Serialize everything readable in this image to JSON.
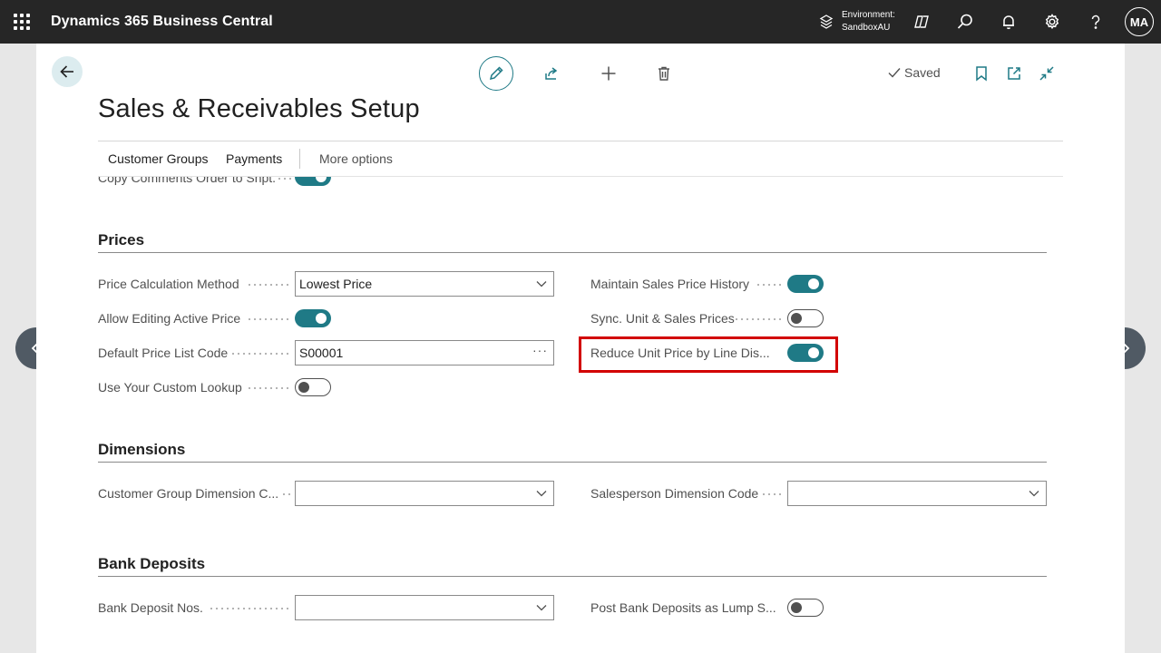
{
  "app": {
    "title": "Dynamics 365 Business Central"
  },
  "topbar": {
    "environment_label": "Environment:",
    "environment_name": "SandboxAU",
    "user_initials": "MA"
  },
  "toolbar": {
    "saved_label": "Saved"
  },
  "page": {
    "title": "Sales & Receivables Setup"
  },
  "tabs": [
    {
      "label": "Customer Groups"
    },
    {
      "label": "Payments"
    },
    {
      "label": "More options"
    }
  ],
  "partial_field": {
    "label": "Copy Comments Order to Shpt.",
    "value": true
  },
  "sections": {
    "prices": {
      "title": "Prices",
      "price_calc": {
        "label": "Price Calculation Method",
        "value": "Lowest Price"
      },
      "allow_edit": {
        "label": "Allow Editing Active Price",
        "value": true
      },
      "default_price_list": {
        "label": "Default Price List Code",
        "value": "S00001"
      },
      "custom_lookup": {
        "label": "Use Your Custom Lookup",
        "value": false
      },
      "maintain_history": {
        "label": "Maintain Sales Price History",
        "value": true
      },
      "sync_unit": {
        "label": "Sync. Unit & Sales Prices",
        "value": false
      },
      "reduce_unit": {
        "label": "Reduce Unit Price by Line Dis...",
        "value": true
      }
    },
    "dimensions": {
      "title": "Dimensions",
      "customer_group_dim": {
        "label": "Customer Group Dimension C...",
        "value": ""
      },
      "salesperson_dim": {
        "label": "Salesperson Dimension Code",
        "value": ""
      }
    },
    "bank_deposits": {
      "title": "Bank Deposits",
      "bank_deposit_nos": {
        "label": "Bank Deposit Nos.",
        "value": ""
      },
      "post_lump": {
        "label": "Post Bank Deposits as Lump S...",
        "value": false
      }
    }
  },
  "colors": {
    "accent": "#1f7a86",
    "topbar": "#262626",
    "highlight": "#d20000"
  }
}
